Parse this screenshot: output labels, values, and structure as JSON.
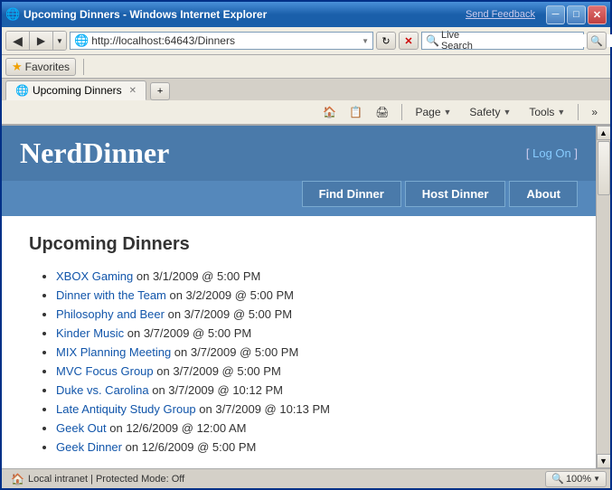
{
  "window": {
    "title": "Upcoming Dinners - Windows Internet Explorer",
    "send_feedback": "Send Feedback"
  },
  "title_bar_buttons": {
    "minimize": "─",
    "maximize": "□",
    "close": "✕"
  },
  "nav": {
    "back": "◀",
    "forward": "▶",
    "dropdown": "▼",
    "refresh": "↻",
    "stop": "✕"
  },
  "address_bar": {
    "url": "http://localhost:64643/Dinners",
    "go_label": "→"
  },
  "search": {
    "placeholder": "Live Search",
    "label": "Live Search",
    "go_label": "🔍"
  },
  "favorites": {
    "label": "Favorites"
  },
  "tabs": [
    {
      "label": "Upcoming Dinners",
      "active": true
    }
  ],
  "commands": {
    "page": "Page",
    "safety": "Safety",
    "tools": "Tools",
    "page_dropdown": "▼",
    "safety_dropdown": "▼",
    "tools_dropdown": "▼"
  },
  "nerd_dinner": {
    "logo": "NerdDinner",
    "login_prefix": "[ ",
    "login_label": "Log On",
    "login_suffix": " ]",
    "nav_items": [
      {
        "label": "Find Dinner"
      },
      {
        "label": "Host Dinner"
      },
      {
        "label": "About"
      }
    ],
    "page_title": "Upcoming Dinners",
    "dinners": [
      {
        "link": "XBOX Gaming",
        "detail": " on 3/1/2009 @ 5:00 PM"
      },
      {
        "link": "Dinner with the Team",
        "detail": " on 3/2/2009 @ 5:00 PM"
      },
      {
        "link": "Philosophy and Beer",
        "detail": " on 3/7/2009 @ 5:00 PM"
      },
      {
        "link": "Kinder Music",
        "detail": " on 3/7/2009 @ 5:00 PM"
      },
      {
        "link": "MIX Planning Meeting",
        "detail": " on 3/7/2009 @ 5:00 PM"
      },
      {
        "link": "MVC Focus Group",
        "detail": " on 3/7/2009 @ 5:00 PM"
      },
      {
        "link": "Duke vs. Carolina",
        "detail": " on 3/7/2009 @ 10:12 PM"
      },
      {
        "link": "Late Antiquity Study Group",
        "detail": " on 3/7/2009 @ 10:13 PM"
      },
      {
        "link": "Geek Out",
        "detail": " on 12/6/2009 @ 12:00 AM"
      },
      {
        "link": "Geek Dinner",
        "detail": " on 12/6/2009 @ 5:00 PM"
      }
    ]
  },
  "status": {
    "zone_text": "Local intranet | Protected Mode: Off",
    "zoom": "100%"
  }
}
